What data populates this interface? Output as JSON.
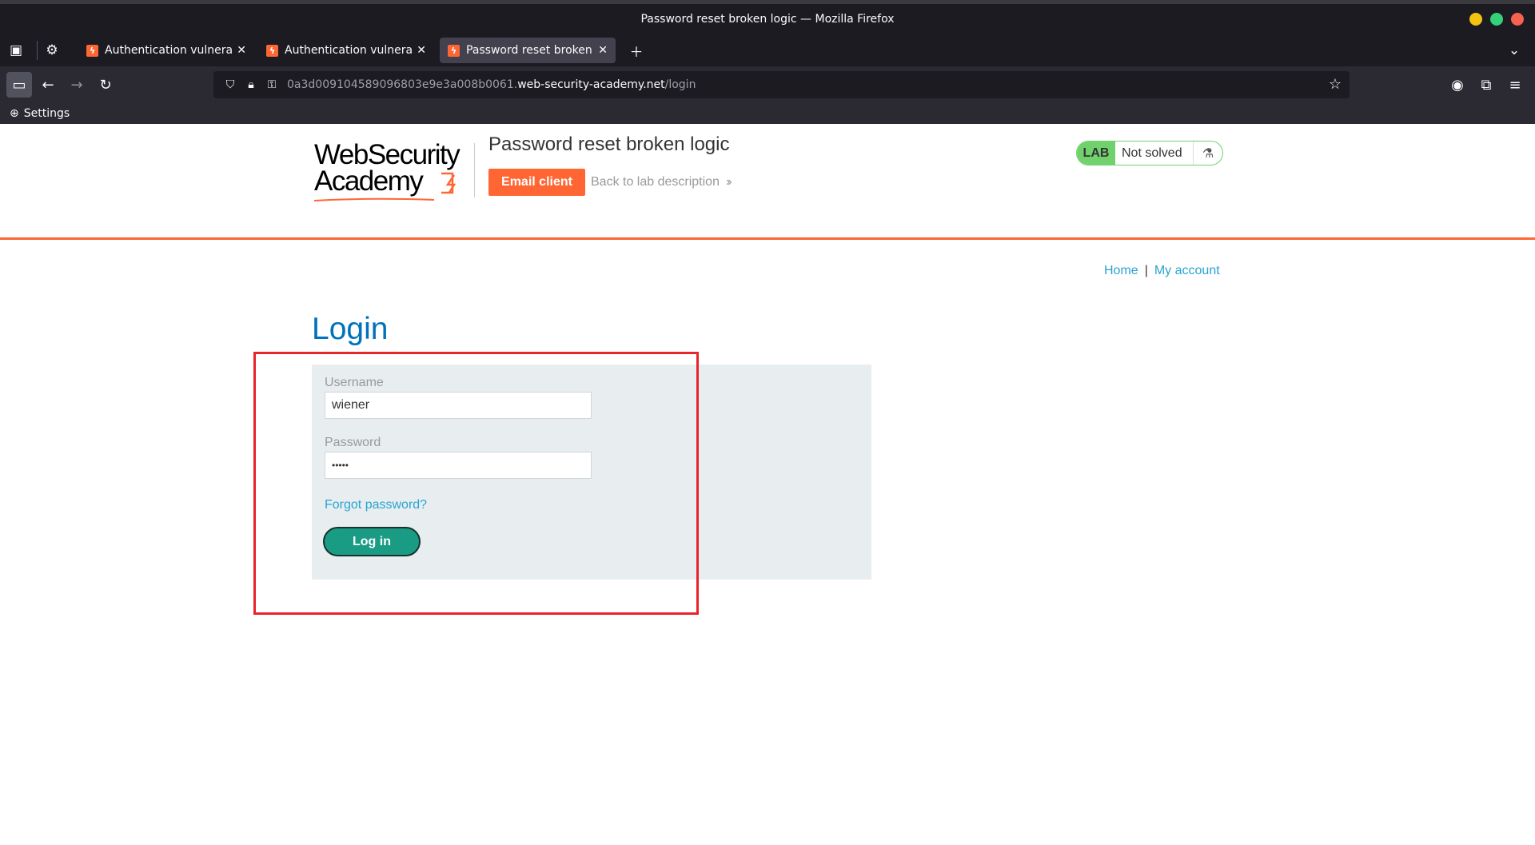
{
  "window": {
    "title": "Password reset broken logic — Mozilla Firefox",
    "controls_colors": [
      "#f5c211",
      "#33d17a",
      "#f66151"
    ]
  },
  "tabs": [
    {
      "label": "Authentication vulnerabil",
      "active": false
    },
    {
      "label": "Authentication vulnerabil",
      "active": false
    },
    {
      "label": "Password reset broken lo",
      "active": true
    }
  ],
  "toolbar": {
    "url_prefix": "0a3d009104589096803e9e3a008b0061.",
    "url_domain": "web-security-academy.net",
    "url_path": "/login"
  },
  "bookmarks": {
    "settings_label": "Settings"
  },
  "header": {
    "logo_line1": "WebSecurity",
    "logo_line2": "Academy",
    "lab_title": "Password reset broken logic",
    "email_client_label": "Email client",
    "back_link_label": "Back to lab description",
    "lab_badge": "LAB",
    "lab_status": "Not solved"
  },
  "nav": {
    "home": "Home",
    "separator": "|",
    "my_account": "My account"
  },
  "login": {
    "heading": "Login",
    "username_label": "Username",
    "username_value": "wiener",
    "password_label": "Password",
    "password_value": "•••••",
    "forgot_label": "Forgot password?",
    "submit_label": "Log in"
  },
  "colors": {
    "accent": "#ff6633",
    "heading_blue": "#0071bc",
    "link_blue": "#29a3d1",
    "lab_green": "#70d16d",
    "button_teal": "#1a9c84",
    "annotation_red": "#e8242a"
  }
}
